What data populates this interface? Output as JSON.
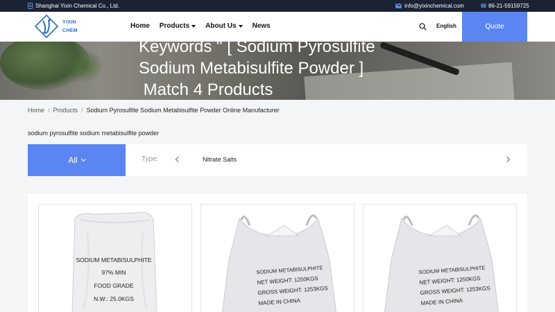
{
  "topbar": {
    "company": "Shanghai Yixin Chemical Co., Ltd.",
    "email": "info@yixinchemical.com",
    "phone": "86-21-59159725"
  },
  "header": {
    "logo_line1": "YIXIN",
    "logo_line2": "CHEM",
    "nav": [
      {
        "label": "Home",
        "has_dropdown": false
      },
      {
        "label": "Products",
        "has_dropdown": true
      },
      {
        "label": "About Us",
        "has_dropdown": true
      },
      {
        "label": "News",
        "has_dropdown": false
      }
    ],
    "language": "English",
    "quote": "Quote"
  },
  "hero": {
    "line1": "Keywords \" [ Sodium Pyrosulfite",
    "line2": "Sodium Metabisulfite Powder ]",
    "line3": " Match 4 Products"
  },
  "breadcrumb": [
    "Home",
    "Products",
    "Sodium Pyrosulfite Sodium Metabisulfite Powder Online Manufacturer"
  ],
  "keyword_text": "sodium pyrosulfite sodium metabisulfite powder",
  "filter": {
    "all_label": "All",
    "type_label": "Type:",
    "type_value": "Nitrate Salts"
  },
  "products": [
    {
      "bag_type": "small-bag",
      "lines": [
        "SODIUM METABISULPHITE",
        "97% MIN",
        "FOOD GRADE",
        "N.W.: 25.0KGS"
      ]
    },
    {
      "bag_type": "jumbo-bag",
      "lines": [
        "SODIUM METABISULPHITE",
        "NET WEIGHT: 1250KGS",
        "GROSS WEIGHT: 1253KGS",
        "MADE IN CHINA"
      ]
    },
    {
      "bag_type": "jumbo-bag",
      "lines": [
        "SODIUM METABISULPHITE",
        "NET WEIGHT: 1250KGS",
        "GROSS WEIGHT: 1253KGS",
        "MADE IN CHINA"
      ]
    }
  ],
  "colors": {
    "accent": "#5b86f2",
    "topbar_bg": "#1a2233"
  }
}
